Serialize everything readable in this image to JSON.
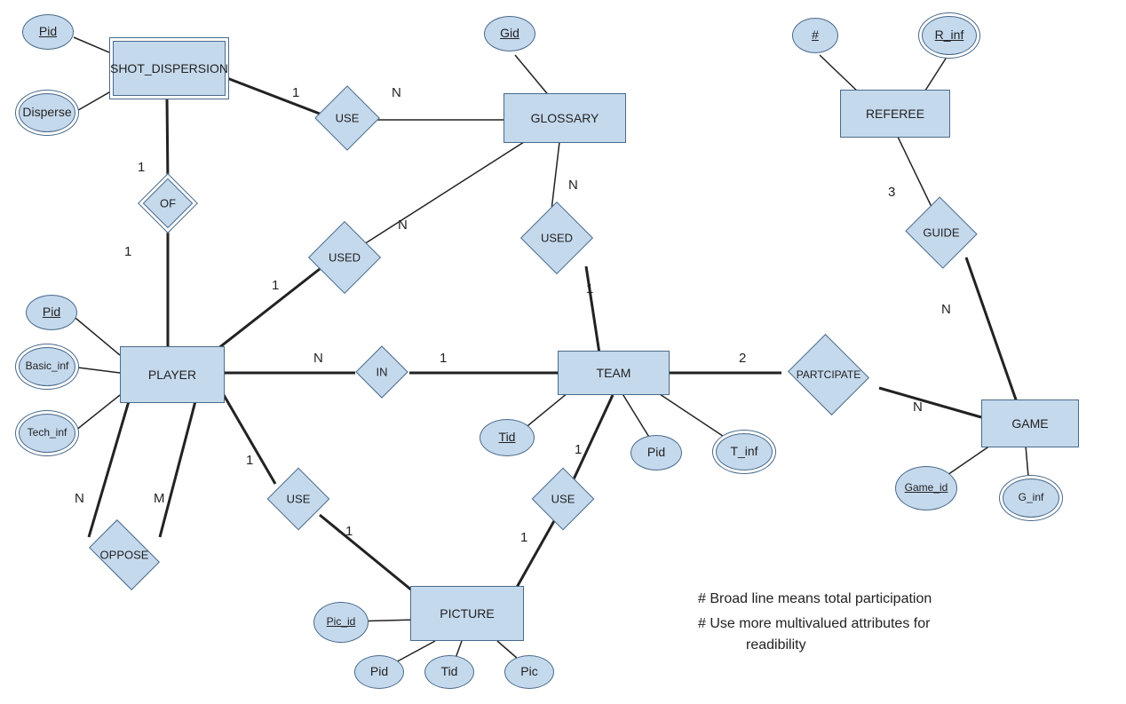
{
  "entities": {
    "shot_dispersion": "SHOT_DISPERSION",
    "player": "PLAYER",
    "glossary": "GLOSSARY",
    "team": "TEAM",
    "picture": "PICTURE",
    "referee": "REFEREE",
    "game": "GAME"
  },
  "relationships": {
    "use_sd_gl": "USE",
    "of": "OF",
    "used_pl_gl": "USED",
    "used_tm_gl": "USED",
    "in": "IN",
    "oppose": "OPPOSE",
    "use_pl_pic": "USE",
    "use_tm_pic": "USE",
    "participate": "PARTCIPATE",
    "guide": "GUIDE"
  },
  "attributes": {
    "sd_pid": "Pid",
    "sd_disperse": "Disperse",
    "gl_gid": "Gid",
    "pl_pid": "Pid",
    "pl_basic": "Basic_inf",
    "pl_tech": "Tech_inf",
    "tm_tid": "Tid",
    "tm_pid": "Pid",
    "tm_tinf": "T_inf",
    "pic_picid": "Pic_id",
    "pic_pid": "Pid",
    "pic_tid": "Tid",
    "pic_pic": "Pic",
    "ref_num": "#",
    "ref_rinf": "R_inf",
    "game_id": "Game_id",
    "game_ginf": "G_inf"
  },
  "cardinalities": {
    "sd_use_1": "1",
    "gl_use_n": "N",
    "sd_of_1": "1",
    "pl_of_1": "1",
    "pl_used_gl_1": "1",
    "gl_used_pl_n": "N",
    "gl_used_tm_n": "N",
    "tm_used_gl_1": "1",
    "pl_in_n": "N",
    "tm_in_1": "1",
    "oppose_n": "N",
    "oppose_m": "M",
    "pl_use_pic_1a": "1",
    "pl_use_pic_1b": "1",
    "tm_use_pic_1a": "1",
    "tm_use_pic_1b": "1",
    "tm_part_2": "2",
    "game_part_n": "N",
    "ref_guide_3": "3",
    "game_guide_n": "N"
  },
  "notes": {
    "n1": "# Broad line means  total participation",
    "n2": "# Use more multivalued attributes for",
    "n3": "readibility"
  }
}
